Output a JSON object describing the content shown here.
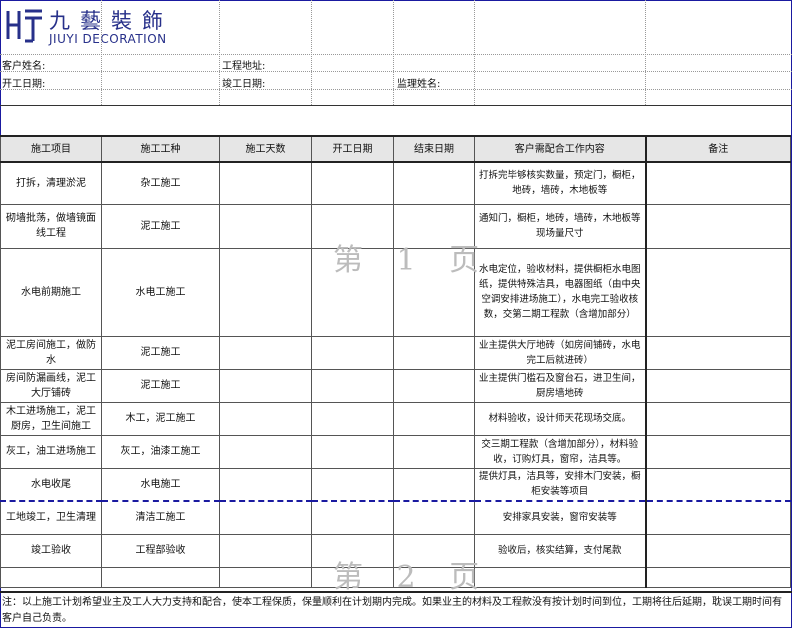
{
  "brand": {
    "name_cn": "九藝裝飾",
    "name_en": "JIUYI DECORATION",
    "color": "#27308a"
  },
  "info": {
    "customer_name_label": "客户姓名:",
    "address_label": "工程地址:",
    "start_date_label": "开工日期:",
    "finish_date_label": "竣工日期:",
    "supervisor_label": "监理姓名:"
  },
  "table": {
    "headers": [
      "施工项目",
      "施工工种",
      "施工天数",
      "开工日期",
      "结束日期",
      "客户需配合工作内容",
      "备注"
    ],
    "rows": [
      {
        "item": "打拆，清理淤泥",
        "trade": "杂工施工",
        "coop": "打拆完毕够核实数量，预定门，橱柜，地砖，墙砖，木地板等"
      },
      {
        "item": "砌墙批荡，做墙镜面线工程",
        "trade": "泥工施工",
        "coop": "通知门，橱柜，地砖，墙砖，木地板等现场量尺寸"
      },
      {
        "item": "水电前期施工",
        "trade": "水电工施工",
        "coop": "水电定位，验收材料，提供橱柜水电图纸，提供特殊洁具，电器图纸（由中央空调安排进场施工），水电完工验收核数，交第二期工程款（含增加部分）"
      },
      {
        "item": "泥工房间施工，做防水",
        "trade": "泥工施工",
        "coop": "业主提供大厅地砖（如房间铺砖，水电完工后就进砖）"
      },
      {
        "item": "房间防漏画线，泥工大厅铺砖",
        "trade": "泥工施工",
        "coop": "业主提供门槛石及窗台石，进卫生间，厨房墙地砖"
      },
      {
        "item": "木工进场施工，泥工厨房，卫生间施工",
        "trade": "木工，泥工施工",
        "coop": "材料验收，设计师天花现场交底。"
      },
      {
        "item": "灰工，油工进场施工",
        "trade": "灰工，油漆工施工",
        "coop": "交三期工程款（含增加部分），材料验收，订购灯具，窗帘，洁具等。"
      },
      {
        "item": "水电收尾",
        "trade": "水电施工",
        "coop": "提供灯具，洁具等，安排木门安装，橱柜安装等项目"
      },
      {
        "item": "工地竣工，卫生清理",
        "trade": "清洁工施工",
        "coop": "安排家具安装，窗帘安装等"
      },
      {
        "item": "竣工验收",
        "trade": "工程部验收",
        "coop": "验收后，核实结算，支付尾款"
      }
    ]
  },
  "watermarks": [
    "第 1 页",
    "第 2 页"
  ],
  "footnote": "注：以上施工计划希望业主及工人大力支持和配合，使本工程保质，保量顺利在计划期内完成。如果业主的材料及工程款没有按计划时间到位，工期将往后延期，耽误工期时间有客户自己负责。"
}
